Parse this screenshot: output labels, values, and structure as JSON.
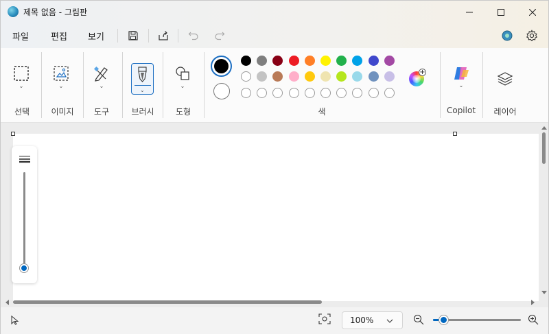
{
  "window": {
    "title": "제목 없음 - 그림판",
    "minimize_icon": "minimize-icon",
    "maximize_icon": "maximize-icon",
    "close_icon": "close-icon"
  },
  "menu": {
    "file": "파일",
    "edit": "편집",
    "view": "보기"
  },
  "ribbon": {
    "groups": {
      "selection": "선택",
      "image": "이미지",
      "tools": "도구",
      "brushes": "브러시",
      "shapes": "도형",
      "colors": "색",
      "copilot": "Copilot",
      "layers": "레이어"
    },
    "primary_color": "#000000",
    "secondary_color": "#ffffff",
    "palette_row1": [
      "#000000",
      "#7f7f7f",
      "#880015",
      "#ed1c24",
      "#ff7f27",
      "#fff200",
      "#22b14c",
      "#00a2e8",
      "#3f48cc",
      "#a349a4"
    ],
    "palette_row2": [
      "#ffffff",
      "#c3c3c3",
      "#b97a57",
      "#ffaec9",
      "#ffc90e",
      "#efe4b0",
      "#b5e61d",
      "#99d9ea",
      "#7092be",
      "#c8bfe7"
    ],
    "palette_row3_count": 10
  },
  "statusbar": {
    "zoom": "100%",
    "zoom_fraction": 0.12
  },
  "brush_size_fraction": 0.0,
  "accent": "#0067c0"
}
